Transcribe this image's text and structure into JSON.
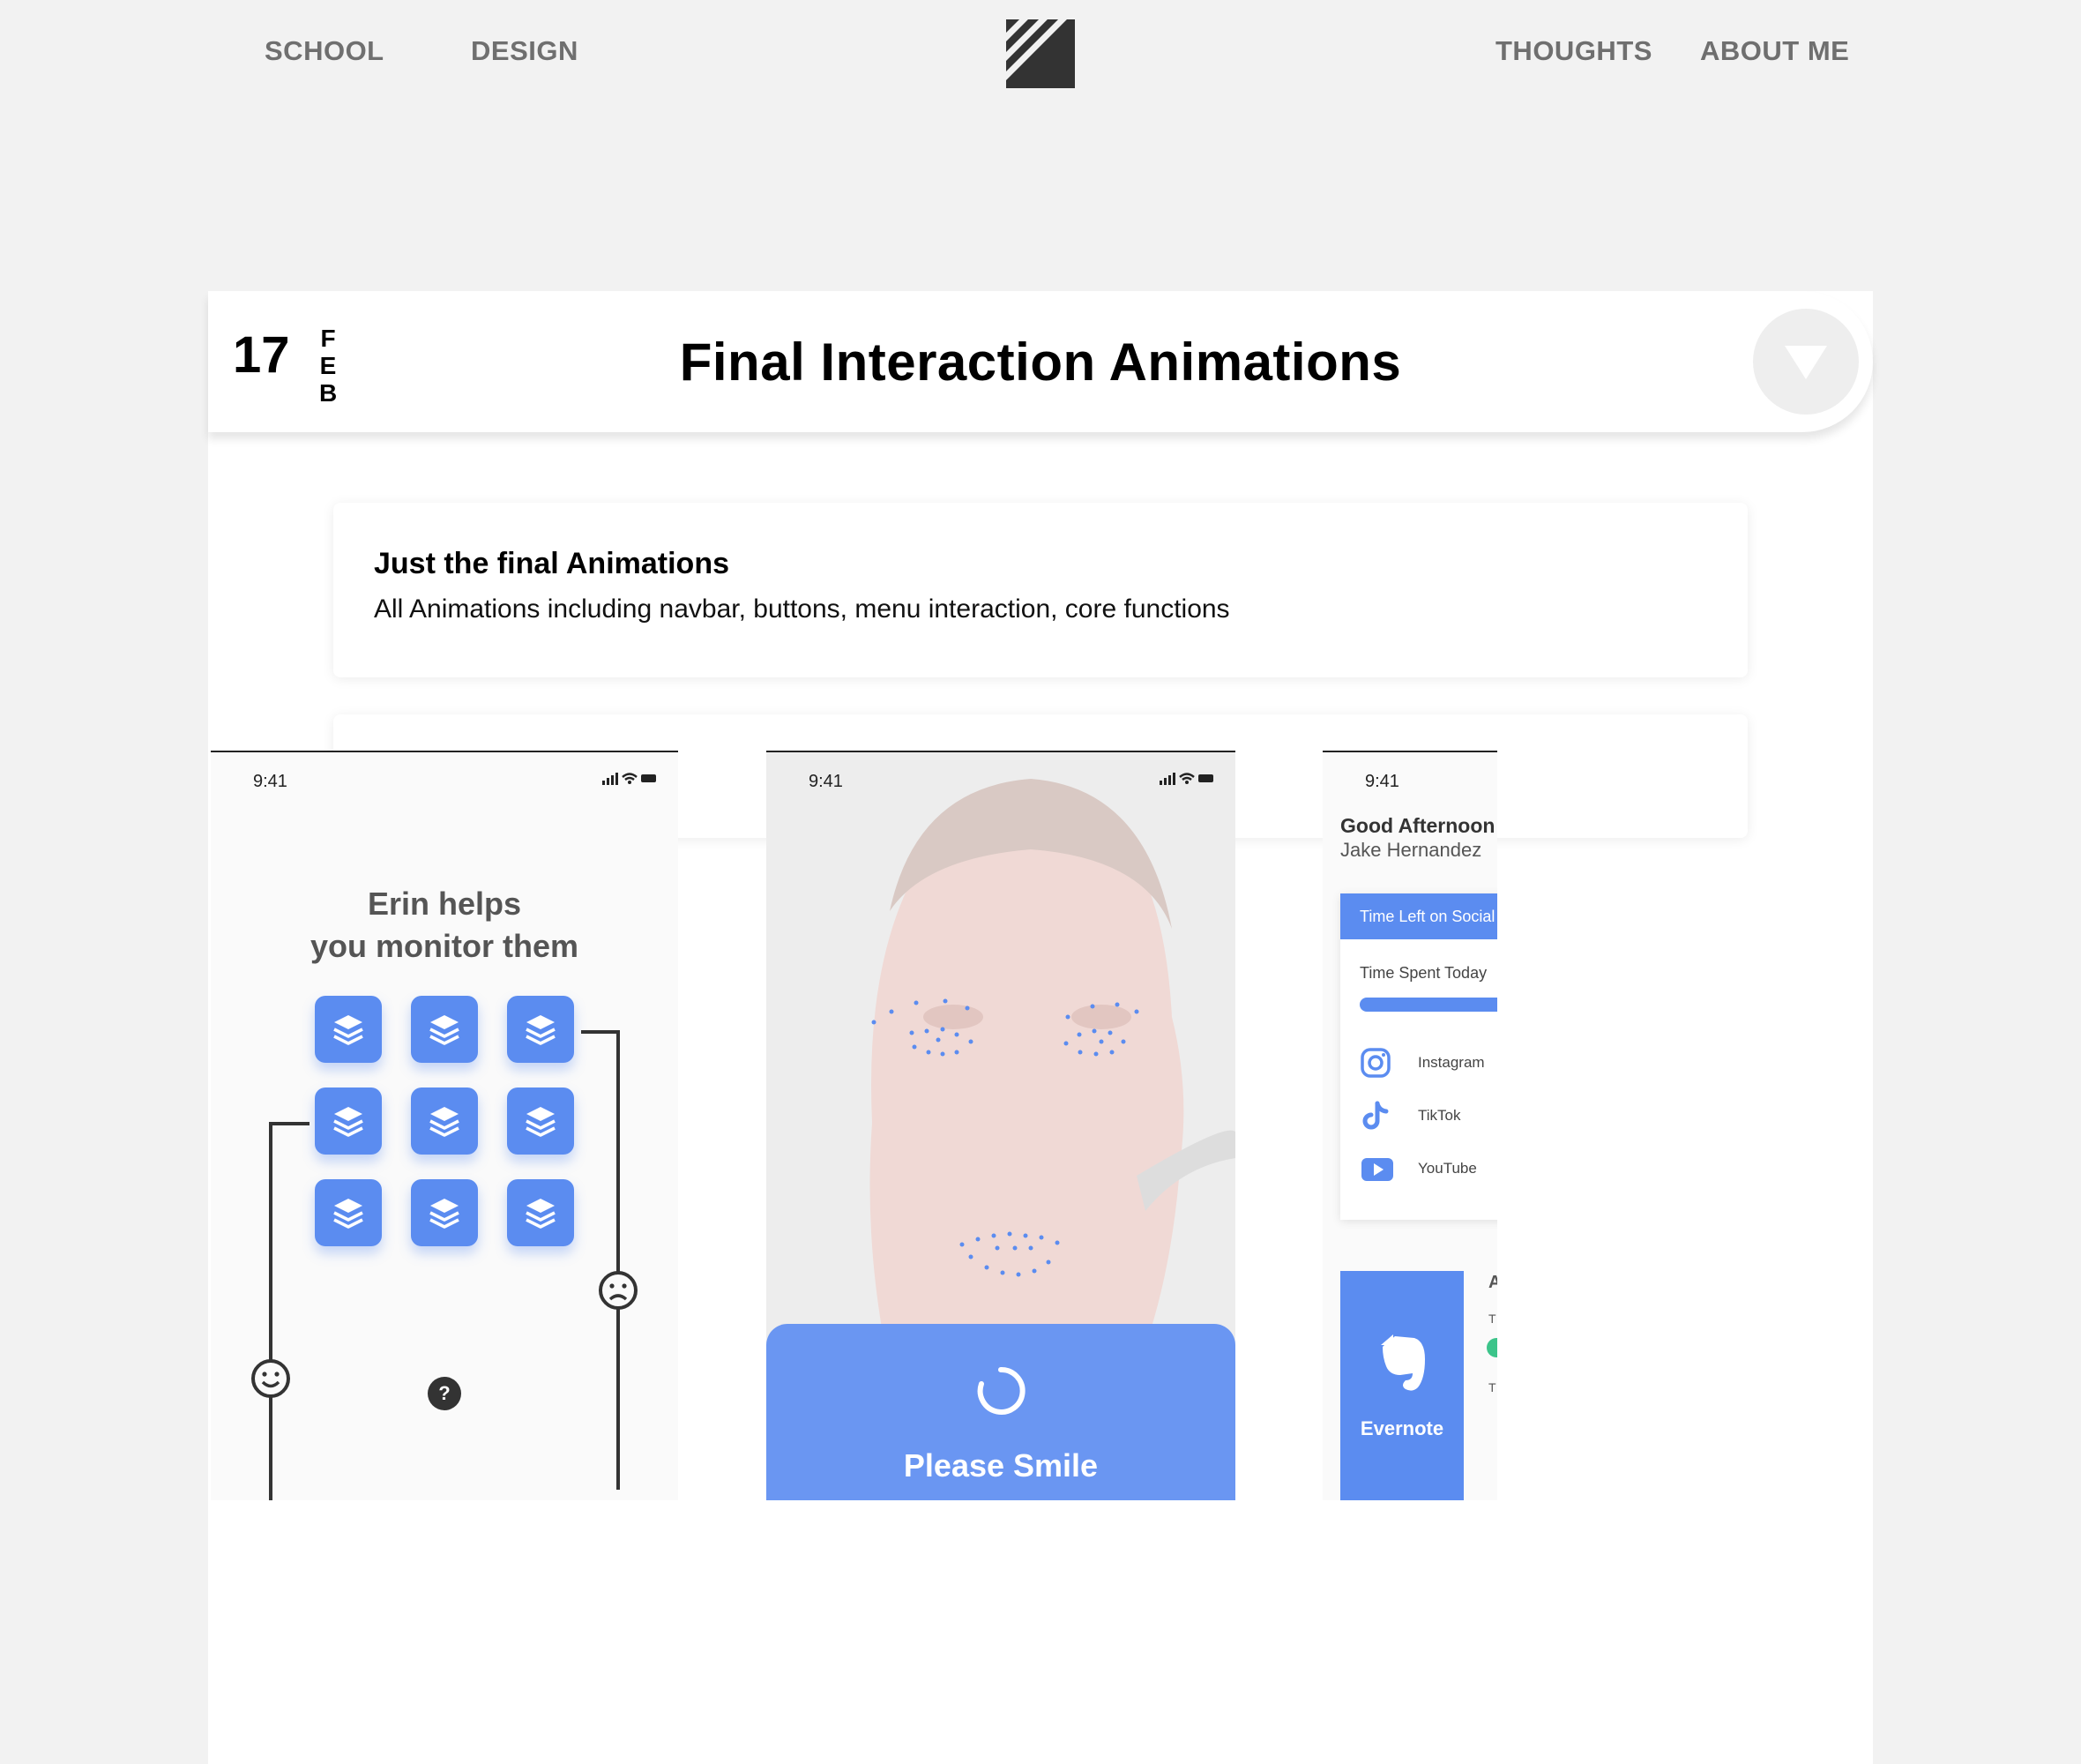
{
  "nav": {
    "school": "SCHOOL",
    "design": "DESIGN",
    "thoughts": "THOUGHTS",
    "about": "ABOUT ME",
    "logo_icon": "striped-square-logo"
  },
  "post": {
    "day": "17",
    "month_letters": [
      "F",
      "E",
      "B"
    ],
    "title": "Final Interaction Animations",
    "toggle_icon": "triangle-down-icon",
    "description": {
      "title": "Just the final Animations",
      "text": "All Animations including navbar, buttons, menu interaction, core functions"
    }
  },
  "phones": [
    {
      "time": "9:41",
      "headline_line1": "Erin helps",
      "headline_line2": "you monitor them",
      "help_label": "?"
    },
    {
      "time": "9:41",
      "button_label": "Please Smile"
    },
    {
      "time": "9:41",
      "greeting": "Good Afternoon",
      "user_name": "Jake Hernandez",
      "card_header": "Time Left on Social",
      "time_spent_label": "Time Spent Today",
      "apps": [
        "Instagram",
        "TikTok",
        "YouTube"
      ],
      "evernote_label": "Evernote",
      "side_fragments": [
        "A",
        "T",
        "T"
      ]
    }
  ],
  "colors": {
    "accent_blue": "#5b8cf0",
    "background": "#f2f2f2",
    "nav_text": "#6f6f6f"
  }
}
